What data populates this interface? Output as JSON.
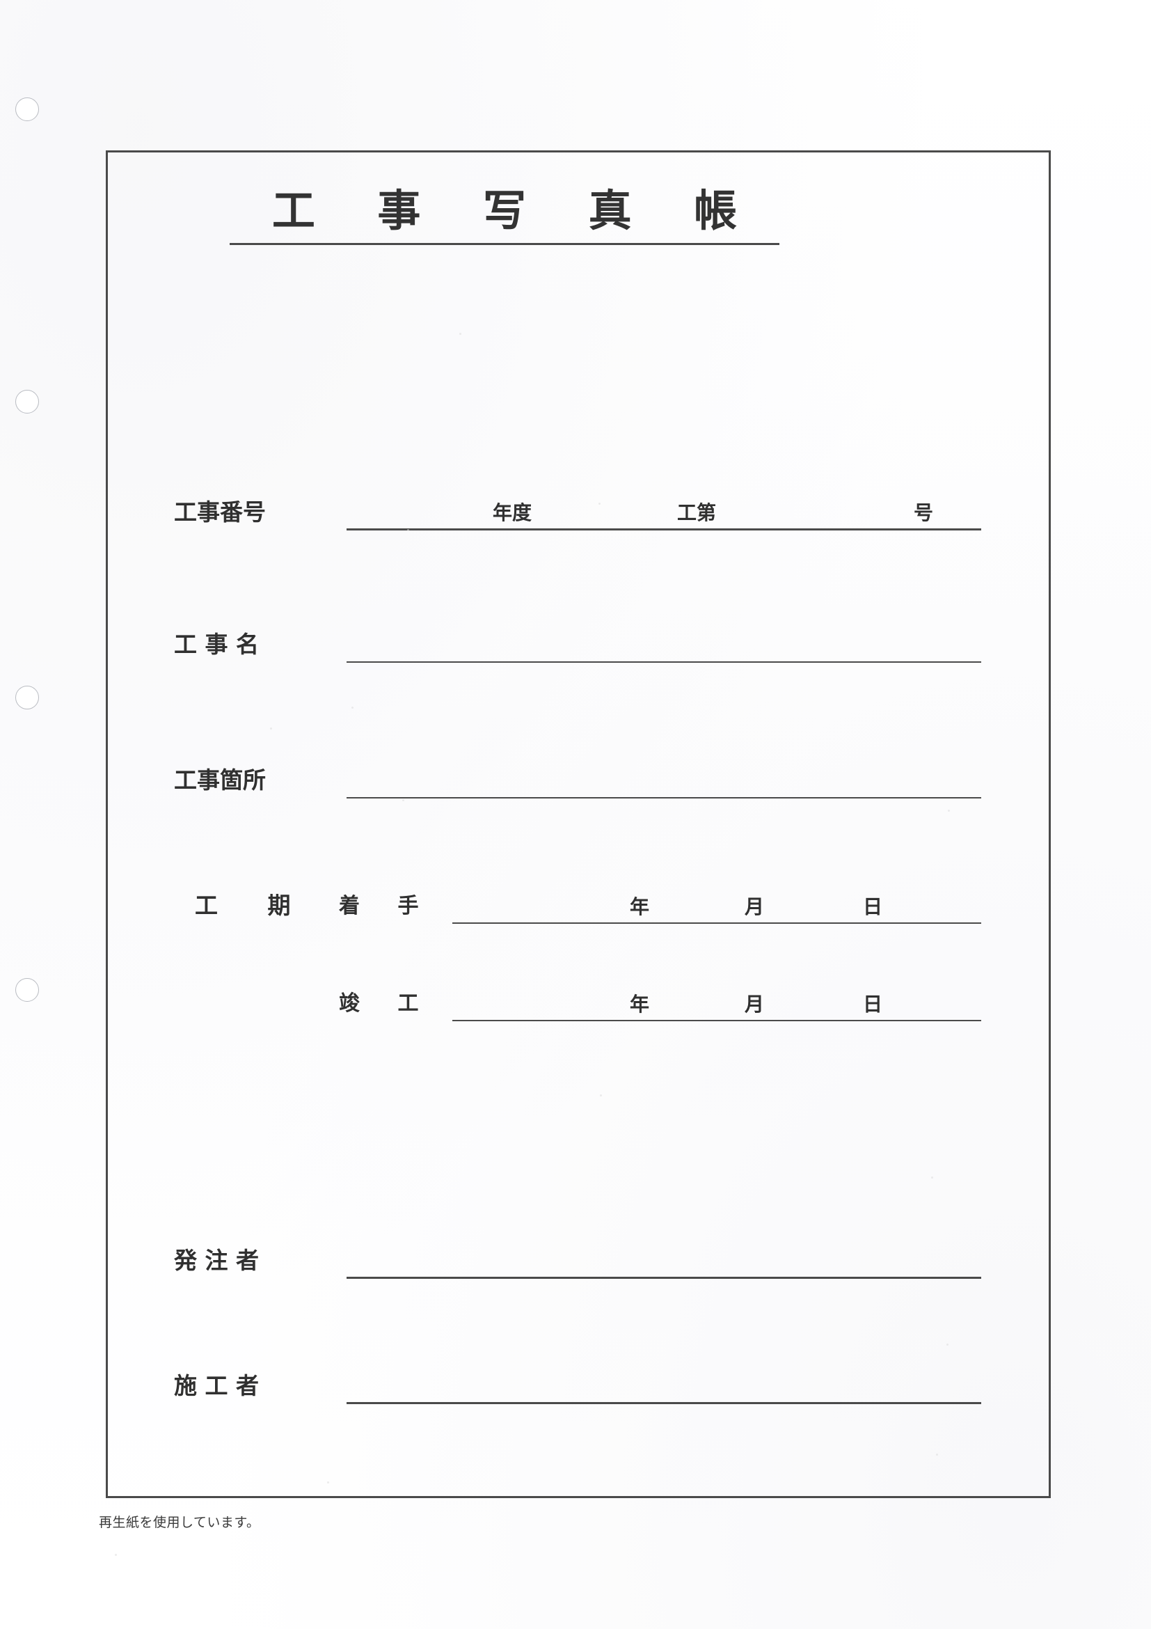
{
  "document": {
    "title": "工 事 写 真 帳",
    "title_plain": "工事写真帳",
    "footer_note": "再生紙を使用しています。",
    "paper_color": "#ffffff",
    "ink_color": "#333333",
    "rule_color": "#4a4a4a"
  },
  "binder": {
    "hole_count": 4,
    "holes": [
      {
        "label": "punch-hole-1"
      },
      {
        "label": "punch-hole-2"
      },
      {
        "label": "punch-hole-3"
      },
      {
        "label": "punch-hole-4"
      }
    ]
  },
  "fields": {
    "project_number": {
      "label": "工事番号",
      "value": "",
      "placeholder": "",
      "units": [
        {
          "text": "年度"
        },
        {
          "text": "工第"
        },
        {
          "text": "号"
        }
      ]
    },
    "project_name": {
      "label": "工 事 名",
      "value": "",
      "placeholder": ""
    },
    "project_location": {
      "label": "工事箇所",
      "value": "",
      "placeholder": ""
    },
    "period": {
      "label": "工  期",
      "start": {
        "sub_label": "着 手",
        "value": "",
        "units": [
          {
            "text": "年"
          },
          {
            "text": "月"
          },
          {
            "text": "日"
          }
        ]
      },
      "completion": {
        "sub_label": "竣 工",
        "value": "",
        "units": [
          {
            "text": "年"
          },
          {
            "text": "月"
          },
          {
            "text": "日"
          }
        ]
      }
    },
    "client": {
      "label": "発 注 者",
      "value": "",
      "placeholder": ""
    },
    "contractor": {
      "label": "施 工 者",
      "value": "",
      "placeholder": ""
    }
  }
}
